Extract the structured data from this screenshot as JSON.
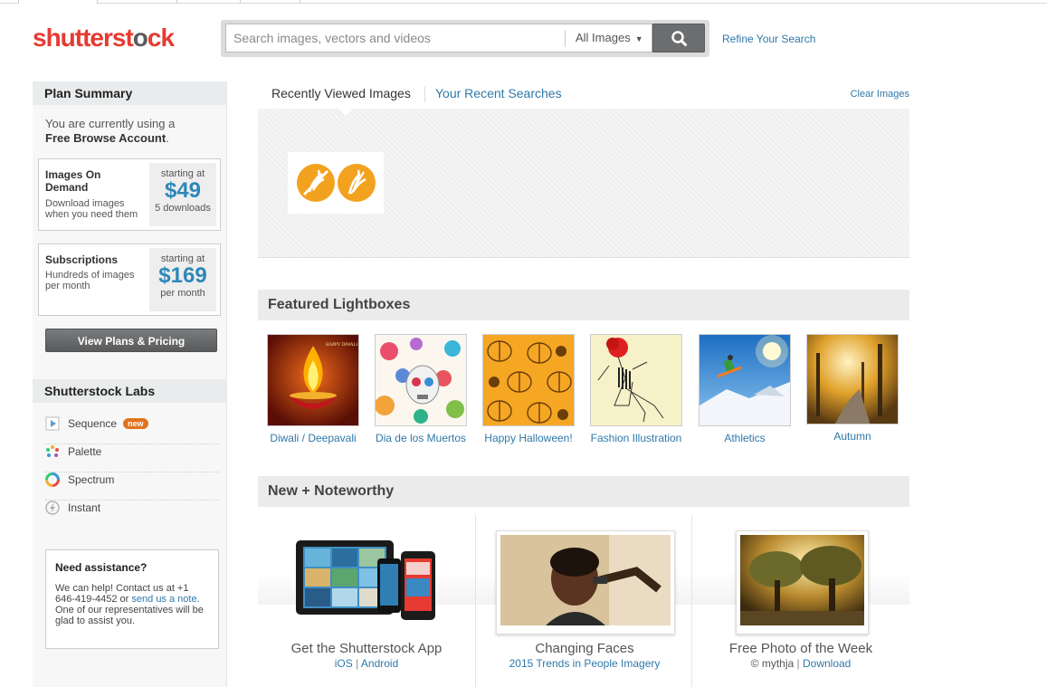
{
  "header": {
    "logo_left": "shutterst",
    "logo_o": "o",
    "logo_right": "ck",
    "search_placeholder": "Search images, vectors and videos",
    "search_type": "All Images",
    "refine_label": "Refine Your Search"
  },
  "sidebar": {
    "plan_title": "Plan Summary",
    "intro_prefix": "You are currently using a",
    "intro_account": "Free Browse Account",
    "intro_suffix": ".",
    "on_demand": {
      "title": "Images On Demand",
      "desc": "Download images when you need them",
      "pre": "starting at",
      "price": "$49",
      "post": "5 downloads"
    },
    "subscriptions": {
      "title": "Subscriptions",
      "desc": "Hundreds of images per month",
      "pre": "starting at",
      "price": "$169",
      "post": "per month"
    },
    "view_plans": "View Plans & Pricing",
    "labs_title": "Shutterstock Labs",
    "labs": [
      {
        "label": "Sequence",
        "badge": "new"
      },
      {
        "label": "Palette"
      },
      {
        "label": "Spectrum"
      },
      {
        "label": "Instant"
      }
    ],
    "assist": {
      "title": "Need assistance?",
      "text_1": "We can help! Contact us at +1 646-419-4452 or ",
      "link": "send us a note",
      "text_2": ". One of our representatives will be glad to assist you."
    }
  },
  "main": {
    "tab_recent": "Recently Viewed Images",
    "tab_searches": "Your Recent Searches",
    "clear_images": "Clear Images",
    "featured_title": "Featured Lightboxes",
    "lightboxes": [
      {
        "label": "Diwali / Deepavali"
      },
      {
        "label": "Dia de los Muertos"
      },
      {
        "label": "Happy Halloween!"
      },
      {
        "label": "Fashion Illustration"
      },
      {
        "label": "Athletics"
      },
      {
        "label": "Autumn"
      }
    ],
    "diwali_banner": "HAPPY DIWALI",
    "noteworthy_title": "New + Noteworthy",
    "noteworthy": [
      {
        "title": "Get the Shutterstock App",
        "link_a": "iOS",
        "sep": "|",
        "link_b": "Android"
      },
      {
        "title": "Changing Faces",
        "link_a": "2015 Trends in People Imagery"
      },
      {
        "title": "Free Photo of the Week",
        "prefix": "© mythja",
        "sep": "|",
        "link_b": "Download"
      }
    ]
  },
  "colors": {
    "brand_red": "#e63a32",
    "link_blue": "#2f78a8",
    "price_blue": "#2f87b8",
    "badge_orange": "#e0731f"
  }
}
